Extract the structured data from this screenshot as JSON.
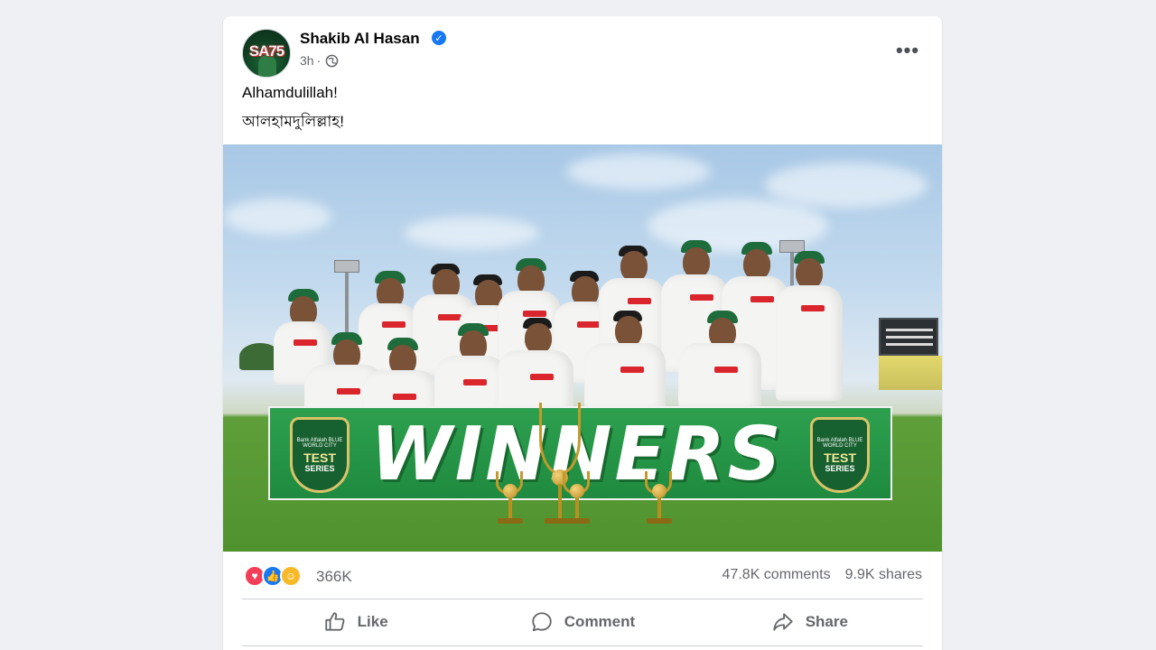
{
  "post": {
    "author": "Shakib Al Hasan",
    "avatar_text": "SA75",
    "time": "3h",
    "separator": "·",
    "text_line_1": "Alhamdulillah!",
    "text_line_2": "আলহামদুলিল্লাহ!",
    "verified_icon": "verified-check-icon",
    "privacy_icon": "globe-icon"
  },
  "photo": {
    "banner_text": "WINNERS",
    "badge_top": "Bank Alfalah BLUE WORLD CITY",
    "badge_test": "TEST",
    "badge_series": "SERIES"
  },
  "stats": {
    "reactions_count": "366K",
    "comments": "47.8K comments",
    "shares": "9.9K shares",
    "reaction_types": [
      "love",
      "like",
      "care"
    ]
  },
  "actions": {
    "like_label": "Like",
    "comment_label": "Comment",
    "share_label": "Share"
  },
  "colors": {
    "accent_blue": "#1877f2",
    "love_red": "#f33e58",
    "care_yellow": "#f7b928",
    "banner_green": "#2da04f",
    "text_secondary": "#65676b"
  }
}
